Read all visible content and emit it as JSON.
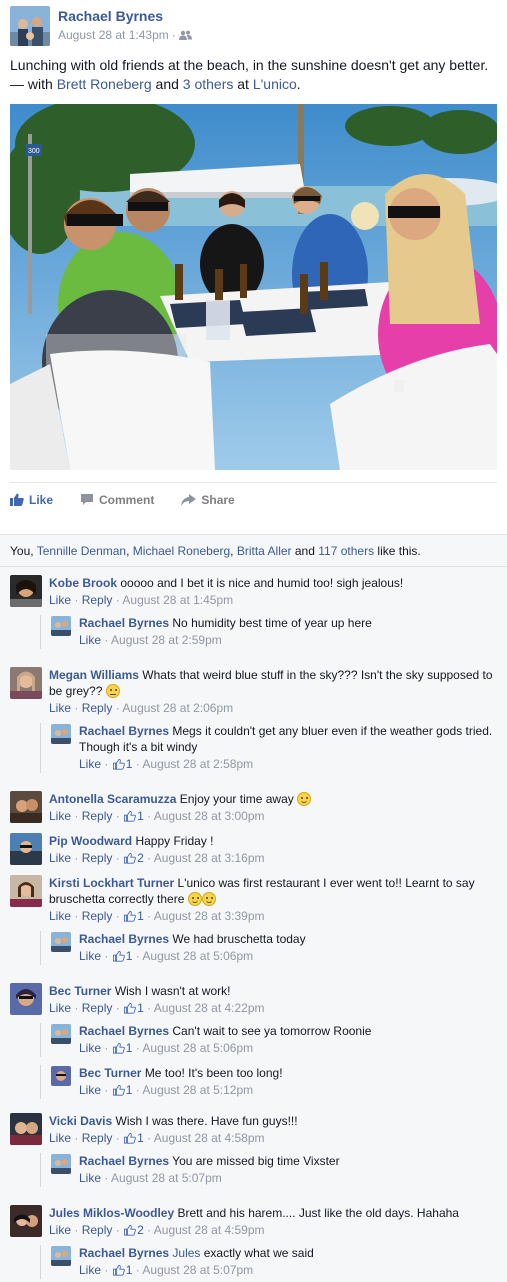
{
  "post": {
    "author": "Rachael Byrnes",
    "timestamp": "August 28 at 1:43pm",
    "privacy_icon": "friends-icon",
    "status_text": "Lunching with old friends at the beach, in the sunshine doesn't get any better.",
    "with_prefix": "— with",
    "tagged_friend": "Brett Roneberg",
    "and_text": "and",
    "others": "3 others",
    "at_text": "at",
    "place": "L'unico",
    "place_period": "."
  },
  "photo": {
    "sign_text": "300"
  },
  "actions": {
    "like": "Like",
    "comment": "Comment",
    "share": "Share"
  },
  "likes": {
    "you": "You,",
    "names": [
      "Tennille Denman",
      "Michael Roneberg",
      "Britta Aller"
    ],
    "and_text": "and",
    "others": "117 others",
    "suffix": "like this."
  },
  "comments": [
    {
      "name": "Kobe Brook",
      "text": "ooooo and I bet it is nice and humid too! sigh jealous!",
      "like": "Like",
      "reply": "Reply",
      "time": "August 28 at 1:45pm",
      "count": ""
    },
    {
      "name": "Rachael Byrnes",
      "text": "No humidity best time of year up here",
      "like": "Like",
      "time": "August 28 at 2:59pm",
      "count": ""
    },
    {
      "name": "Megan Williams",
      "text": "Whats that weird blue stuff in the sky??? Isn't the sky supposed to be grey??",
      "like": "Like",
      "reply": "Reply",
      "time": "August 28 at 2:06pm",
      "count": ""
    },
    {
      "name": "Rachael Byrnes",
      "text": "Megs it couldn't get any bluer even if the weather gods tried. Though it's a bit windy",
      "like": "Like",
      "time": "August 28 at 2:58pm",
      "count": "1"
    },
    {
      "name": "Antonella Scaramuzza",
      "text": "Enjoy your time away",
      "like": "Like",
      "reply": "Reply",
      "time": "August 28 at 3:00pm",
      "count": "1"
    },
    {
      "name": "Pip Woodward",
      "text": "Happy Friday !",
      "like": "Like",
      "reply": "Reply",
      "time": "August 28 at 3:16pm",
      "count": "2"
    },
    {
      "name": "Kirsti Lockhart Turner",
      "text": "L'unico was first restaurant I ever went to!! Learnt to say bruschetta correctly there",
      "like": "Like",
      "reply": "Reply",
      "time": "August 28 at 3:39pm",
      "count": "1"
    },
    {
      "name": "Rachael Byrnes",
      "text": "We had bruschetta today",
      "like": "Like",
      "time": "August 28 at 5:06pm",
      "count": "1"
    },
    {
      "name": "Bec Turner",
      "text": "Wish I wasn't at work!",
      "like": "Like",
      "reply": "Reply",
      "time": "August 28 at 4:22pm",
      "count": "1"
    },
    {
      "name": "Rachael Byrnes",
      "text": "Can't wait to see ya tomorrow Roonie",
      "like": "Like",
      "time": "August 28 at 5:06pm",
      "count": "1"
    },
    {
      "name": "Bec Turner",
      "text": "Me too! It's been too long!",
      "like": "Like",
      "time": "August 28 at 5:12pm",
      "count": "1"
    },
    {
      "name": "Vicki Davis",
      "text": "Wish I was there. Have fun guys!!!",
      "like": "Like",
      "reply": "Reply",
      "time": "August 28 at 4:58pm",
      "count": "1"
    },
    {
      "name": "Rachael Byrnes",
      "text": "You are missed big time Vixster",
      "like": "Like",
      "time": "August 28 at 5:07pm",
      "count": ""
    },
    {
      "name": "Jules Miklos-Woodley",
      "text": "Brett and his harem.... Just like the old days. Hahaha",
      "like": "Like",
      "reply": "Reply",
      "time": "August 28 at 4:59pm",
      "count": "2"
    },
    {
      "name": "Rachael Byrnes",
      "mention": "Jules",
      "text": "exactly what we said",
      "like": "Like",
      "time": "August 28 at 5:07pm",
      "count": "1"
    }
  ],
  "sep": "·",
  "colors": {
    "link": "#3b5998",
    "meta": "#9197a3",
    "like_active": "#4267b2",
    "feedback_bg": "#f6f7f9"
  }
}
